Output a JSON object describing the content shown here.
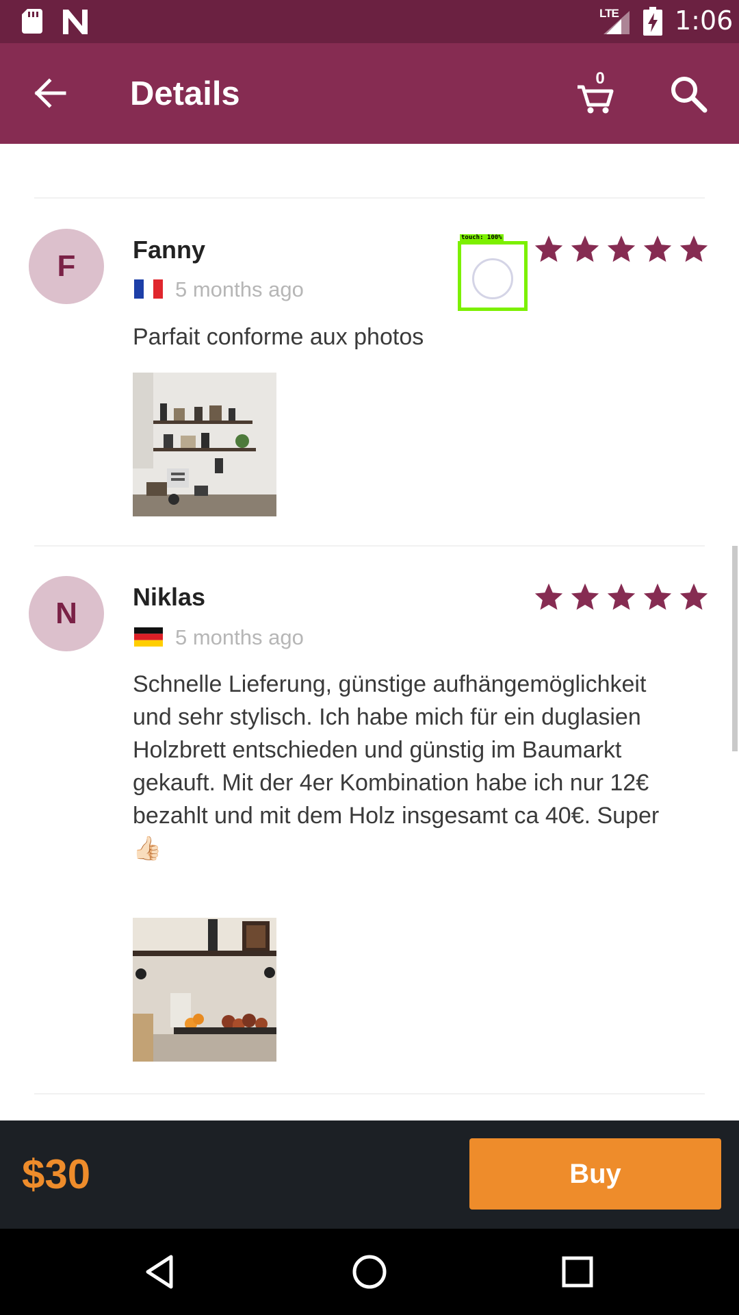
{
  "status_bar": {
    "network": "LTE",
    "time": "1:06",
    "icons": [
      "sd-card-icon",
      "n-notification-icon",
      "signal-icon",
      "battery-charging-icon"
    ]
  },
  "toolbar": {
    "title": "Details",
    "cart_count": "0",
    "icons": [
      "back-arrow-icon",
      "cart-icon",
      "search-icon"
    ]
  },
  "colors": {
    "status_bar": "#6b2141",
    "toolbar": "#862c52",
    "accent": "#ee8c2b",
    "star": "#862c52",
    "avatar_bg": "#dcc0cc"
  },
  "reviews": [
    {
      "initial": "F",
      "name": "Fanny",
      "country_flag": "flag-france-icon",
      "date": "5 months ago",
      "rating": 5,
      "text": "Parfait conforme aux photos",
      "photo": "kitchen-shelves-photo"
    },
    {
      "initial": "N",
      "name": "Niklas",
      "country_flag": "flag-germany-icon",
      "date": "5 months ago",
      "rating": 5,
      "text": "Schnelle Lieferung, günstige aufhängemöglichkeit und sehr stylisch. Ich habe mich für ein duglasien Holzbrett entschieden und günstig im Baumarkt gekauft. Mit der 4er Kombination habe ich nur 12€ bezahlt und mit dem Holz insgesamt ca 40€. Super 👍🏻",
      "photo": "fruit-shelf-photo"
    }
  ],
  "touch_indicator": {
    "label": "touch: 100%"
  },
  "buy_bar": {
    "price": "$30",
    "button_label": "Buy"
  },
  "nav_bar": {
    "icons": [
      "nav-back-icon",
      "nav-home-icon",
      "nav-recents-icon"
    ]
  }
}
